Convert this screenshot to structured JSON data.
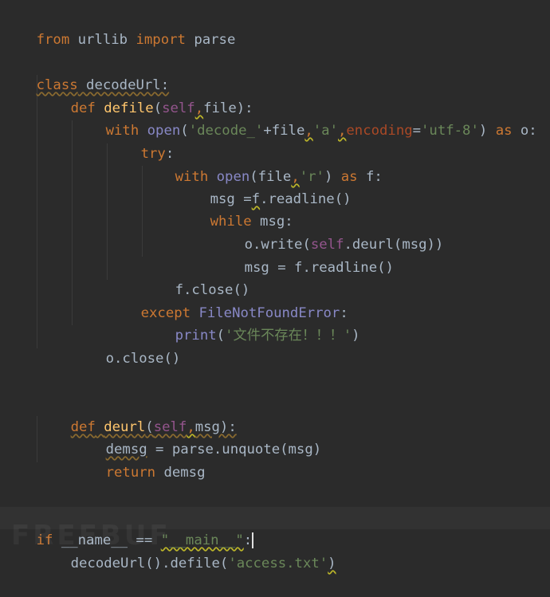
{
  "colors": {
    "background": "#2b2b2b",
    "keyword": "#cc7832",
    "function": "#ffc66d",
    "string": "#6a8759",
    "self": "#94558d",
    "builtin": "#8888c6",
    "parameter": "#aa4926",
    "text": "#a9b7c6"
  },
  "code": {
    "l1": {
      "t1": "from",
      "t2": " urllib ",
      "t3": "import",
      "t4": " parse"
    },
    "l3": {
      "t1": "class",
      "t2": " decodeUrl:"
    },
    "l4": {
      "t1": "def",
      "t2": " ",
      "t3": "defile",
      "t4": "(",
      "t5": "self",
      "t6": ",",
      "t7": "file):"
    },
    "l5": {
      "t1": "with",
      "t2": " ",
      "t3": "open",
      "t4": "(",
      "t5": "'decode_'",
      "t6": "+file",
      "t7": ",",
      "t8": "'a'",
      "t9": ",",
      "t10": "encoding",
      "t11": "=",
      "t12": "'utf-8'",
      "t13": ") ",
      "t14": "as",
      "t15": " o:"
    },
    "l6": {
      "t1": "try",
      "t2": ":"
    },
    "l7": {
      "t1": "with",
      "t2": " ",
      "t3": "open",
      "t4": "(file",
      "t5": ",",
      "t6": "'r'",
      "t7": ") ",
      "t8": "as",
      "t9": " f:"
    },
    "l8": {
      "t1": "msg =",
      "t2": "f",
      "t3": ".readline()"
    },
    "l9": {
      "t1": "while",
      "t2": " msg:"
    },
    "l10": {
      "t1": "o.write(",
      "t2": "self",
      "t3": ".deurl(msg))"
    },
    "l11": {
      "t1": "msg = f.readline()"
    },
    "l12": {
      "t1": "f.close()"
    },
    "l13": {
      "t1": "except",
      "t2": " ",
      "t3": "FileNotFoundError",
      "t4": ":"
    },
    "l14": {
      "t1": "print",
      "t2": "(",
      "t3": "'文件不存在！！！'",
      "t4": ")"
    },
    "l15": {
      "t1": "o.close()"
    },
    "l18": {
      "t1": "def",
      "t2": " ",
      "t3": "deurl",
      "t4": "(",
      "t5": "self",
      "t6": ",",
      "t7": "msg):"
    },
    "l19": {
      "t1": "demsg",
      "t2": " = parse.unquote(msg)"
    },
    "l20": {
      "t1": "return",
      "t2": " demsg"
    },
    "l23": {
      "t1": "if",
      "t2": " __name__ == ",
      "t3": "\"__main__\"",
      "t4": ":"
    },
    "l24": {
      "t1": "decodeUrl().defile(",
      "t2": "'access.txt'",
      "t3": ")"
    }
  },
  "watermark": "FREEBUF"
}
